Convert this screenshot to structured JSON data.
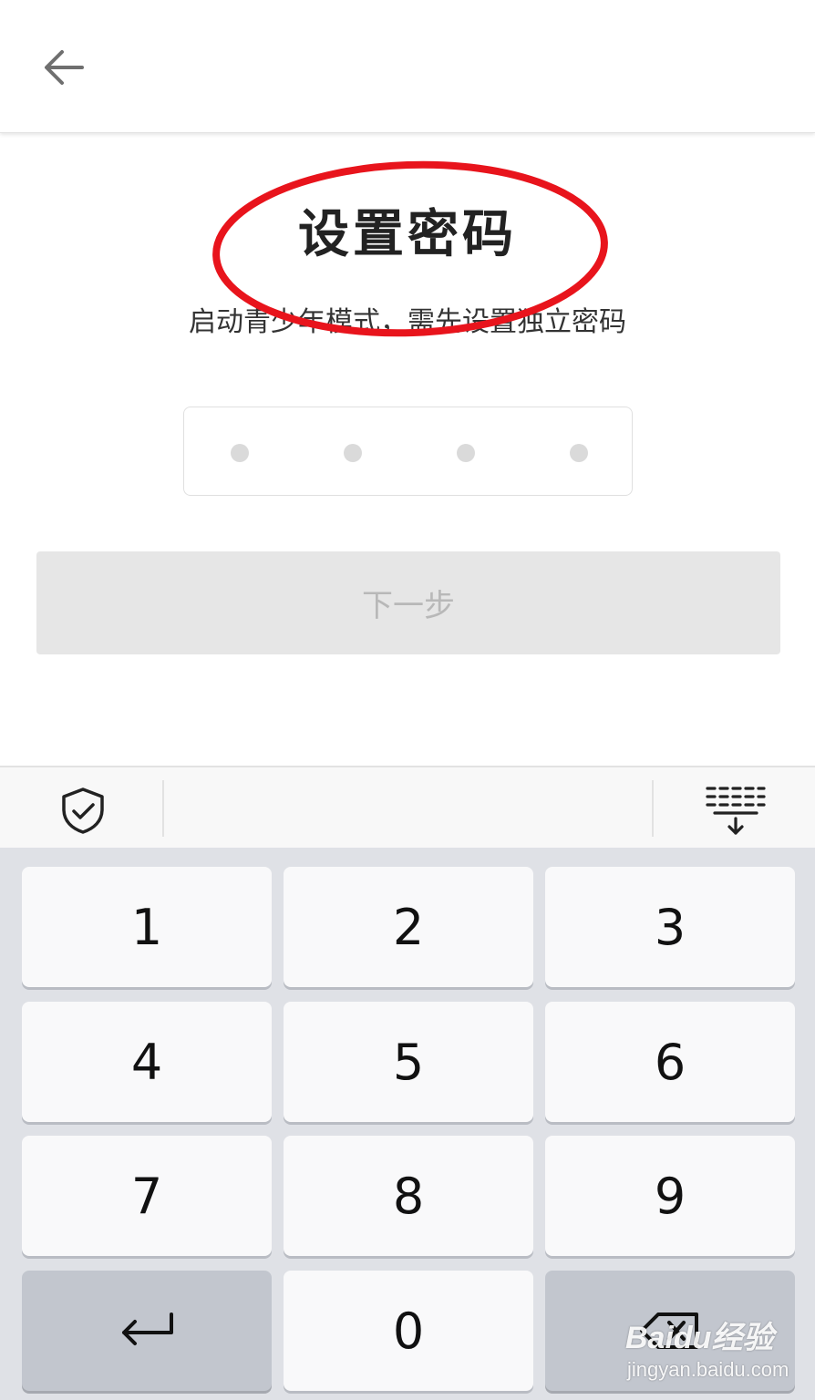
{
  "header": {
    "back_icon": "arrow-left-icon"
  },
  "main": {
    "title": "设置密码",
    "subtitle": "启动青少年模式，需先设置独立密码",
    "pin_length": 4,
    "next_button": "下一步",
    "highlight_color": "#e8141c"
  },
  "keyboard": {
    "toolbar": {
      "left_icon": "shield-check-icon",
      "right_icon": "keyboard-collapse-icon"
    },
    "keys": {
      "k1": "1",
      "k2": "2",
      "k3": "3",
      "k4": "4",
      "k5": "5",
      "k6": "6",
      "k7": "7",
      "k8": "8",
      "k9": "9",
      "k0": "0"
    },
    "enter_icon": "enter-arrow-icon",
    "delete_icon": "backspace-icon"
  },
  "watermark": {
    "brand": "Baidu经验",
    "url": "jingyan.baidu.com"
  }
}
